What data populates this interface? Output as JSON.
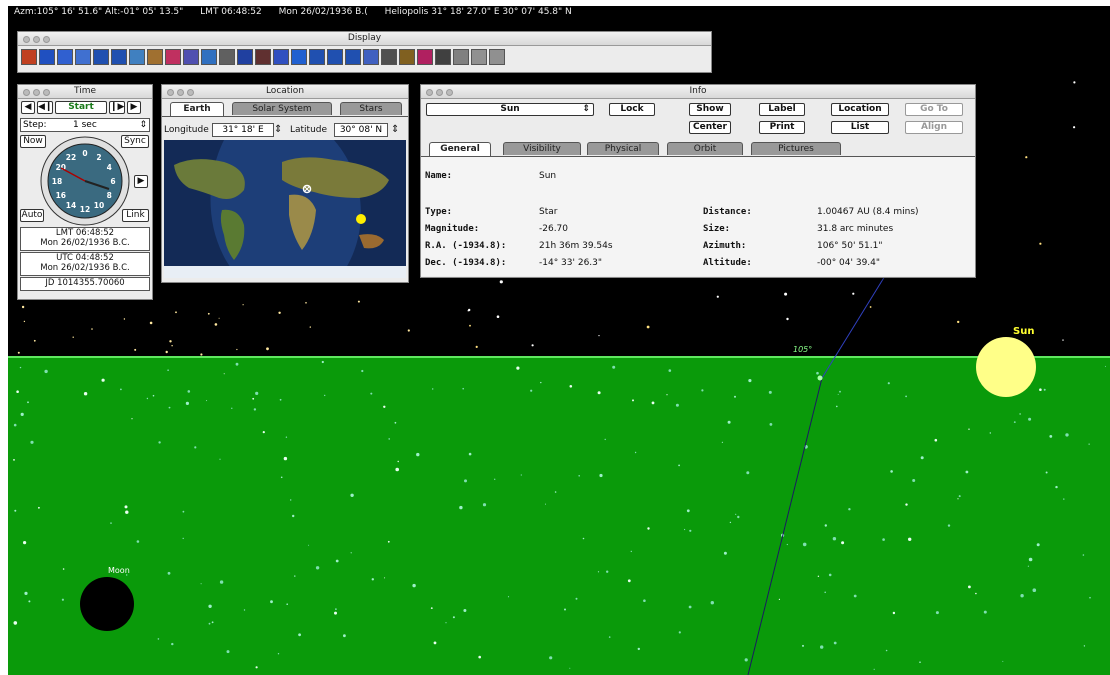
{
  "status_bar": {
    "azm_alt": "Azm:105° 16' 51.6\" Alt:-01° 05' 13.5\"",
    "lmt": "LMT 06:48:52",
    "date": "Mon  26/02/1936 B.(",
    "site": "Heliopolis  31° 18' 27.0\" E  30° 07' 45.8\" N"
  },
  "display_window": {
    "title": "Display",
    "toolbar": [
      {
        "icon": "planets-icon",
        "color": "#c04020"
      },
      {
        "icon": "comets-icon",
        "color": "#2050c0"
      },
      {
        "icon": "constellation-icon",
        "color": "#3060d0"
      },
      {
        "icon": "star-cluster-icon",
        "color": "#4070d0"
      },
      {
        "icon": "arrows-up-icon",
        "color": "#2050b0"
      },
      {
        "icon": "arrows-down-icon",
        "color": "#2050b0"
      },
      {
        "icon": "lines-icon",
        "color": "#4080c0"
      },
      {
        "icon": "figure-icon",
        "color": "#a07030"
      },
      {
        "icon": "boundaries-icon",
        "color": "#c03060"
      },
      {
        "icon": "labels-icon",
        "color": "#5050b0"
      },
      {
        "icon": "zodiac-icon",
        "color": "#3070c0"
      },
      {
        "icon": "binoculars-icon",
        "color": "#606060"
      },
      {
        "icon": "messier-icon",
        "color": "#2040a0"
      },
      {
        "icon": "nebula-icon",
        "color": "#603030"
      },
      {
        "icon": "milky-way-icon",
        "color": "#3050c0"
      },
      {
        "icon": "galaxy-icon",
        "color": "#2060d0"
      },
      {
        "icon": "sort-up-icon",
        "color": "#2050b0"
      },
      {
        "icon": "sort-down-icon",
        "color": "#2050b0"
      },
      {
        "icon": "grid-icon",
        "color": "#2050b0"
      },
      {
        "icon": "horizon-icon",
        "color": "#4060c0"
      },
      {
        "icon": "abc-labels-icon",
        "color": "#505050"
      },
      {
        "icon": "landscape-icon",
        "color": "#806020"
      },
      {
        "icon": "color-palette-icon",
        "color": "#b02060"
      },
      {
        "icon": "panel-icon",
        "color": "#404040"
      },
      {
        "icon": "pencil-icon",
        "color": "#808080"
      },
      {
        "icon": "circle-arrow-icon",
        "color": "#909090"
      },
      {
        "icon": "telescope-icon",
        "color": "#909090"
      }
    ]
  },
  "time_window": {
    "title": "Time",
    "start_label": "Start",
    "step_label": "Step:",
    "step_value": "1 sec",
    "now_label": "Now",
    "sync_label": "Sync",
    "auto_label": "Auto",
    "link_label": "Link",
    "clock_numbers": [
      "22",
      "0",
      "2",
      "20",
      "4",
      "18",
      "6",
      "16",
      "8",
      "14",
      "12",
      "10"
    ],
    "lmt_time": "LMT 06:48:52",
    "lmt_date": "Mon 26/02/1936 B.C.",
    "utc_time": "UTC 04:48:52",
    "utc_date": "Mon 26/02/1936 B.C.",
    "jd": "JD 1014355.70060"
  },
  "location_window": {
    "title": "Location",
    "tabs": [
      "Earth",
      "Solar System",
      "Stars"
    ],
    "longitude_label": "Longitude",
    "longitude_value": "31° 18' E",
    "latitude_label": "Latitude",
    "latitude_value": "30° 08' N"
  },
  "info_window": {
    "title": "Info",
    "object": "Sun",
    "buttons": {
      "lock": "Lock",
      "show": "Show",
      "center": "Center",
      "label": "Label",
      "print": "Print",
      "location": "Location",
      "list": "List",
      "goto": "Go To",
      "align": "Align"
    },
    "tabs": [
      "General",
      "Visibility",
      "Physical",
      "Orbit",
      "Pictures"
    ],
    "fields": {
      "name_label": "Name:",
      "name_value": "Sun",
      "type_label": "Type:",
      "type_value": "Star",
      "magnitude_label": "Magnitude:",
      "magnitude_value": "-26.70",
      "ra_label": "R.A. (-1934.8):",
      "ra_value": "21h 36m 39.54s",
      "dec_label": "Dec. (-1934.8):",
      "dec_value": "-14° 33' 26.3\"",
      "distance_label": "Distance:",
      "distance_value": "1.00467 AU (8.4 mins)",
      "size_label": "Size:",
      "size_value": "31.8 arc minutes",
      "azimuth_label": "Azimuth:",
      "azimuth_value": "106° 50' 51.1\"",
      "altitude_label": "Altitude:",
      "altitude_value": "-00° 04' 39.4\""
    }
  },
  "sky": {
    "sun_label": "Sun",
    "moon_label": "Moon",
    "azimuth_marker": "105°",
    "colors": {
      "sky": "#000000",
      "ground": "#0a9a0a",
      "sun": "#ffff88",
      "moon": "#000000",
      "sun_label": "#ffff30"
    }
  }
}
